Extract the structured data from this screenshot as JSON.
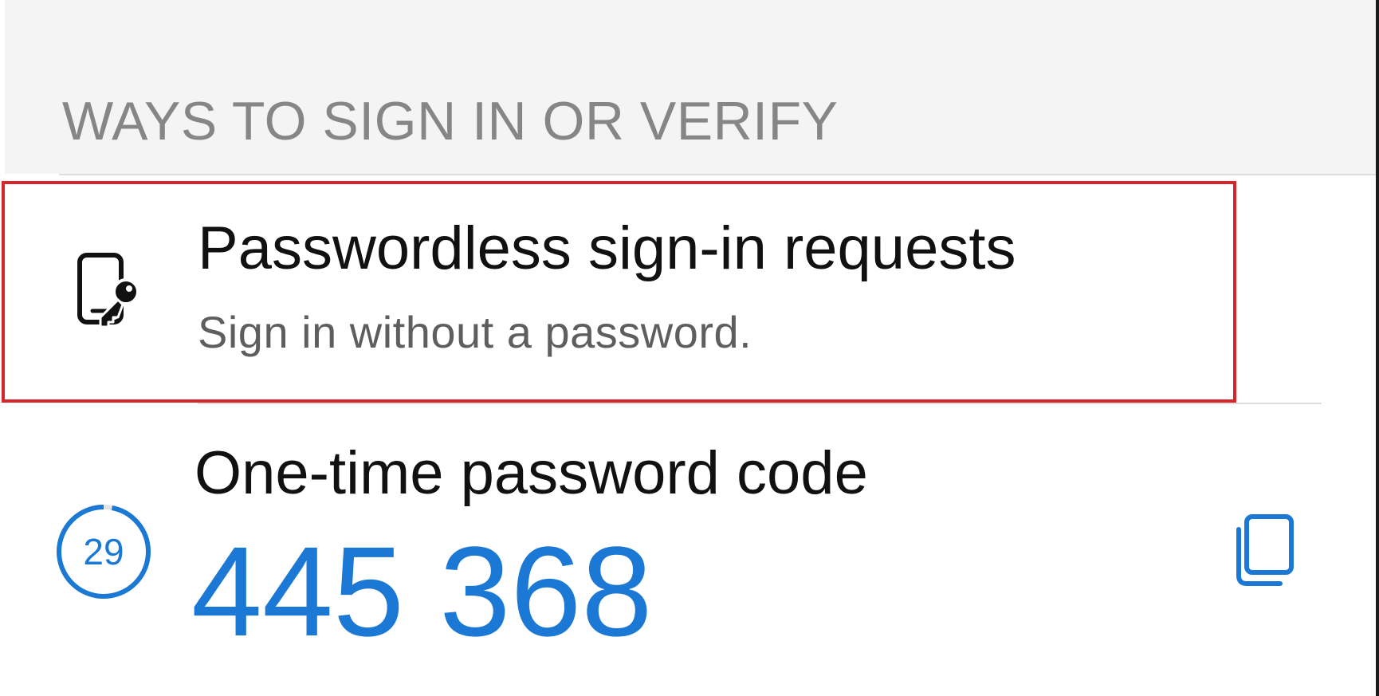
{
  "section": {
    "header": "WAYS TO SIGN IN OR VERIFY"
  },
  "passwordless": {
    "title": "Passwordless sign-in requests",
    "subtitle": "Sign in without a password.",
    "icon": "phone-key-icon"
  },
  "otp": {
    "title": "One-time password code",
    "code": "445 368",
    "countdown_seconds": "29",
    "countdown_remaining_fraction": 0.97,
    "copy_icon": "copy-icon"
  },
  "colors": {
    "accent": "#1b78d4",
    "highlight": "#d6262b",
    "header_background": "#f4f4f4",
    "header_text": "#868686",
    "subtitle_text": "#5e5e5e"
  }
}
